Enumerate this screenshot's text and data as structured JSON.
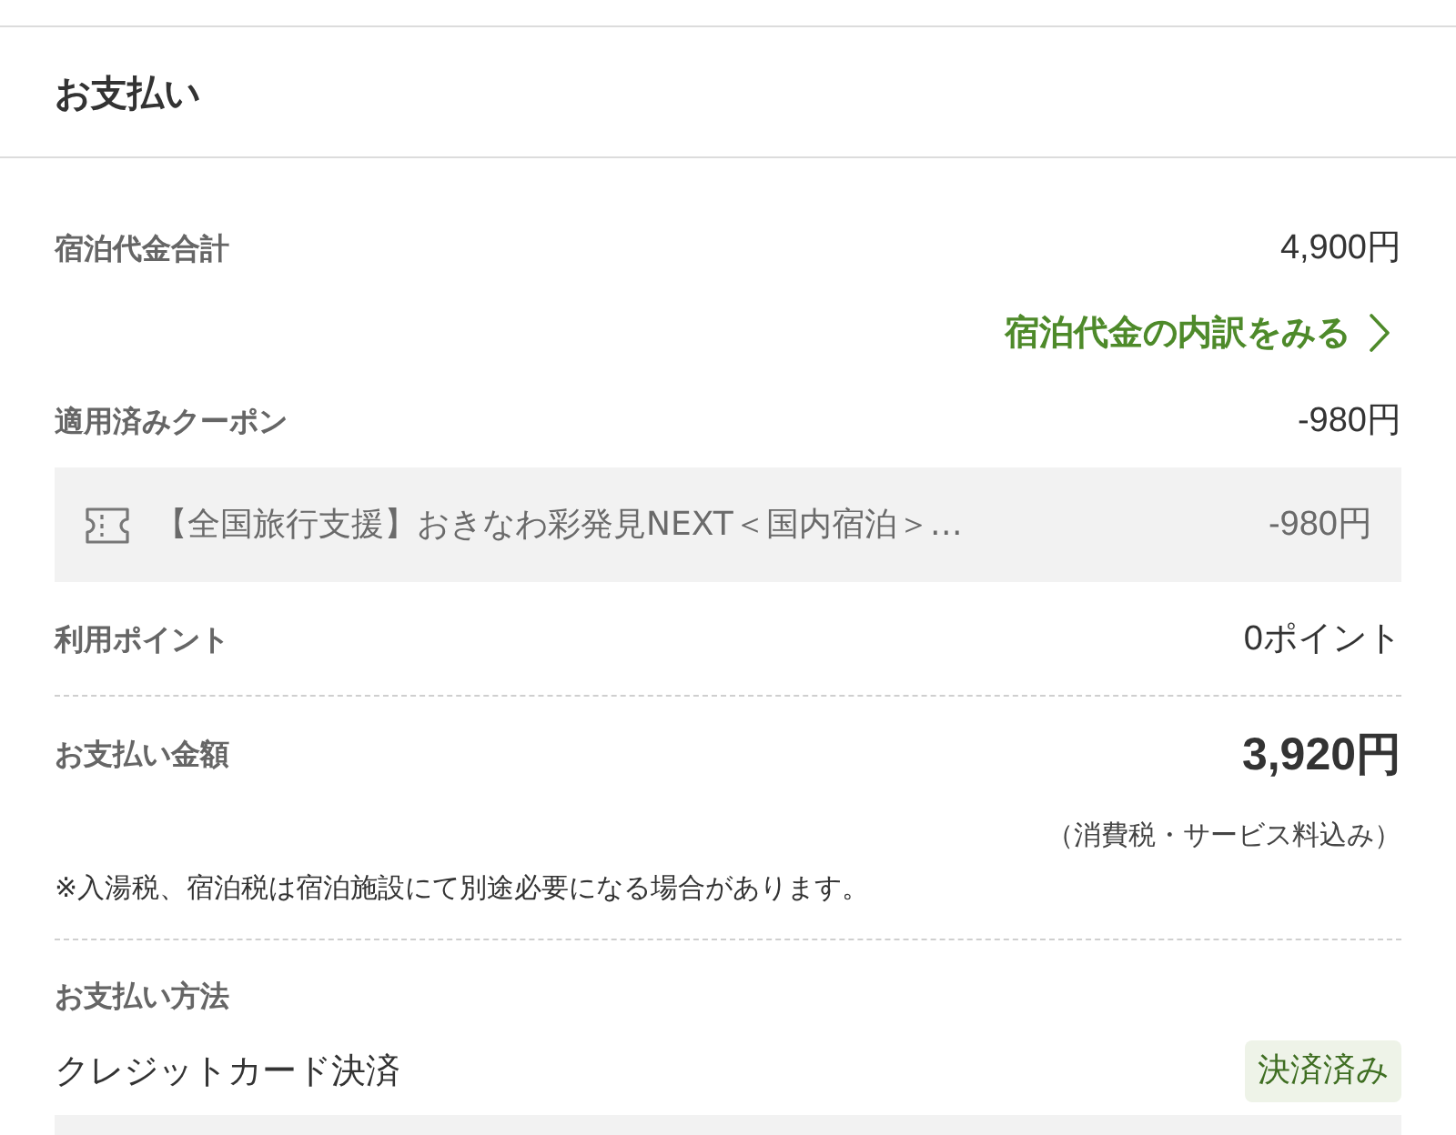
{
  "header": {
    "title": "お支払い"
  },
  "lodging_total": {
    "label": "宿泊代金合計",
    "value": "4,900円"
  },
  "breakdown_link": {
    "label": "宿泊代金の内訳をみる"
  },
  "coupons": {
    "label": "適用済みクーポン",
    "value": "-980円",
    "items": [
      {
        "name": "【全国旅行支援】おきなわ彩発見NEXT＜国内宿泊＞…",
        "amount": "-980円"
      }
    ]
  },
  "points": {
    "label": "利用ポイント",
    "value": "0ポイント"
  },
  "payment_amount": {
    "label": "お支払い金額",
    "value": "3,920円",
    "tax_note": "（消費税・サービス料込み）"
  },
  "notice": "※入湯税、宿泊税は宿泊施設にて別途必要になる場合があります。",
  "payment_method": {
    "label": "お支払い方法",
    "method": "クレジットカード決済",
    "status": "決済済み"
  }
}
